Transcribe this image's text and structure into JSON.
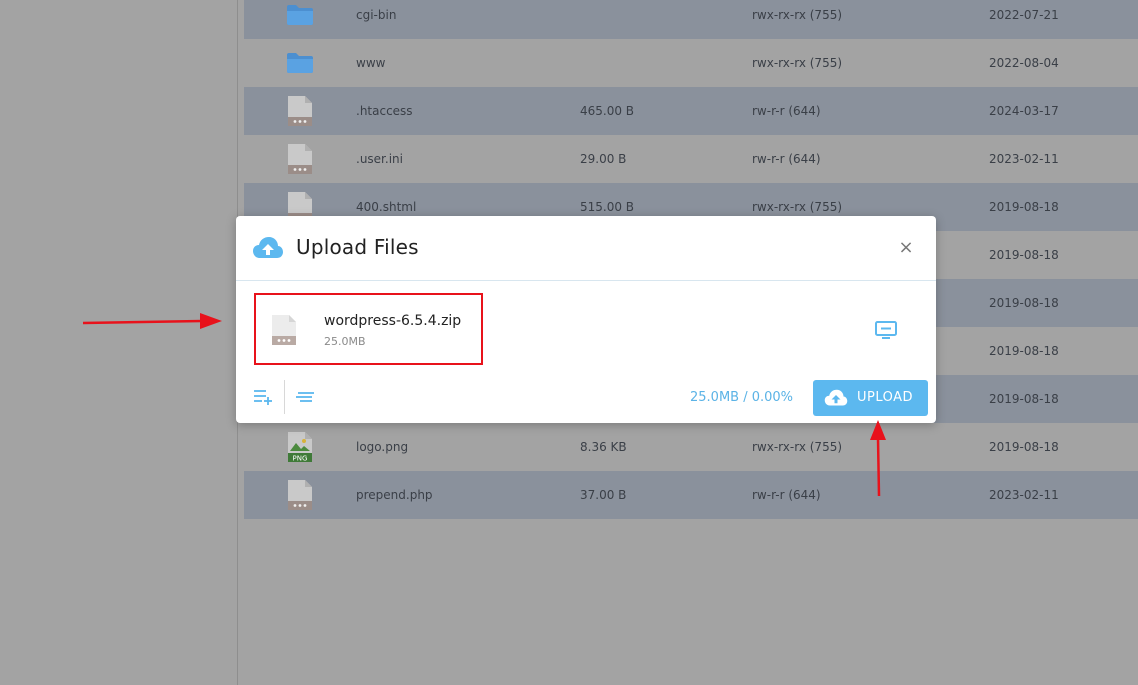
{
  "files": [
    {
      "name": "cgi-bin",
      "size": "",
      "perm": "rwx-rx-rx (755)",
      "date": "2022-07-21",
      "icon": "folder-icon",
      "alt": true
    },
    {
      "name": "www",
      "size": "",
      "perm": "rwx-rx-rx (755)",
      "date": "2022-08-04",
      "icon": "folder-icon",
      "alt": false
    },
    {
      "name": ".htaccess",
      "size": "465.00 B",
      "perm": "rw-r-r (644)",
      "date": "2024-03-17",
      "icon": "file-icon",
      "alt": true
    },
    {
      "name": ".user.ini",
      "size": "29.00 B",
      "perm": "rw-r-r (644)",
      "date": "2023-02-11",
      "icon": "file-icon",
      "alt": false
    },
    {
      "name": "400.shtml",
      "size": "515.00 B",
      "perm": "rwx-rx-rx (755)",
      "date": "2019-08-18",
      "icon": "file-icon",
      "alt": true
    },
    {
      "name": "",
      "size": "",
      "perm": "",
      "date": "2019-08-18",
      "icon": "file-icon",
      "alt": false
    },
    {
      "name": "",
      "size": "",
      "perm": "",
      "date": "2019-08-18",
      "icon": "file-icon",
      "alt": true
    },
    {
      "name": "",
      "size": "",
      "perm": "",
      "date": "2019-08-18",
      "icon": "file-icon",
      "alt": false
    },
    {
      "name": "",
      "size": "",
      "perm": "",
      "date": "2019-08-18",
      "icon": "file-icon",
      "alt": true
    },
    {
      "name": "logo.png",
      "size": "8.36 KB",
      "perm": "rwx-rx-rx (755)",
      "date": "2019-08-18",
      "icon": "png-icon",
      "alt": false
    },
    {
      "name": "prepend.php",
      "size": "37.00 B",
      "perm": "rw-r-r (644)",
      "date": "2023-02-11",
      "icon": "file-icon",
      "alt": true
    }
  ],
  "modal": {
    "title": "Upload Files",
    "close_label": "×",
    "queued_file": {
      "name": "wordpress-6.5.4.zip",
      "size": "25.0MB"
    },
    "progress": "25.0MB / 0.00%",
    "upload_label": "UPLOAD",
    "png_badge": "PNG"
  },
  "colors": {
    "accent": "#5cb8ef",
    "highlight": "#e8121b",
    "arrow": "#e8121b"
  }
}
